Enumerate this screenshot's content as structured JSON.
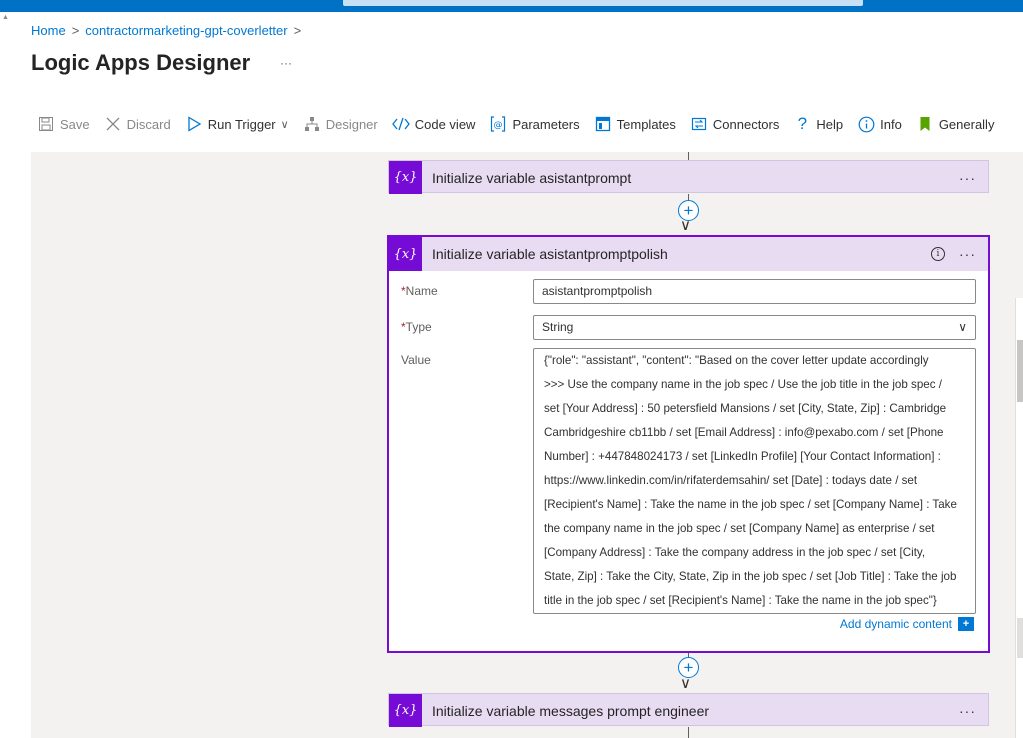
{
  "breadcrumb": {
    "home": "Home",
    "sep1": ">",
    "resource": "contractormarketing-gpt-coverletter",
    "sep2": ">"
  },
  "page": {
    "title": "Logic Apps Designer",
    "more": "···"
  },
  "toolbar": {
    "save": "Save",
    "discard": "Discard",
    "run_trigger": "Run Trigger",
    "designer": "Designer",
    "code_view": "Code view",
    "parameters": "Parameters",
    "templates": "Templates",
    "connectors": "Connectors",
    "help": "Help",
    "info": "Info",
    "generally": "Generally"
  },
  "icons": {
    "variable": "{x}",
    "more": "···",
    "info": "i",
    "add": "+",
    "arrow_down": "∨",
    "chevron_down": "∨",
    "dynamic_plus": "+"
  },
  "cards": {
    "top": {
      "title": "Initialize variable asistantprompt"
    },
    "active": {
      "title": "Initialize variable asistantpromptpolish",
      "name_label": "Name",
      "name_required": "*",
      "name_value": "asistantpromptpolish",
      "type_label": "Type",
      "type_required": "*",
      "type_value": "String",
      "value_label": "Value",
      "value_lines": [
        "  {\"role\": \"assistant\", \"content\": \"Based on the cover letter update accordingly",
        ">>> Use the company name in the job spec / Use the job title in the job spec /",
        "set [Your Address] : 50 petersfield Mansions / set [City, State, Zip] : Cambridge",
        "Cambridgeshire cb11bb / set [Email Address] : info@pexabo.com / set [Phone",
        "Number] : +447848024173 / set [LinkedIn Profile]  [Your Contact Information] :",
        "https://www.linkedin.com/in/rifaterdemsahin/ set [Date] : todays date / set",
        "[Recipient's Name] : Take the name in the job spec / set [Company Name] : Take",
        "the company name in the job spec / set [Company Name] as enterprise / set",
        "[Company Address] : Take the company address in the job spec / set [City,",
        "State, Zip] : Take the City, State, Zip in the job spec / set [Job Title] : Take the job",
        "title in the job spec / set [Recipient's Name] : Take the name in the job spec\"}"
      ],
      "dynamic_content": "Add dynamic content"
    },
    "bottom": {
      "title": "Initialize variable messages prompt engineer"
    }
  },
  "colors": {
    "accent": "#0078d4",
    "variable_purple": "#770bd6",
    "card_bg": "#e8dcf3",
    "canvas_bg": "#f3f2f1"
  }
}
